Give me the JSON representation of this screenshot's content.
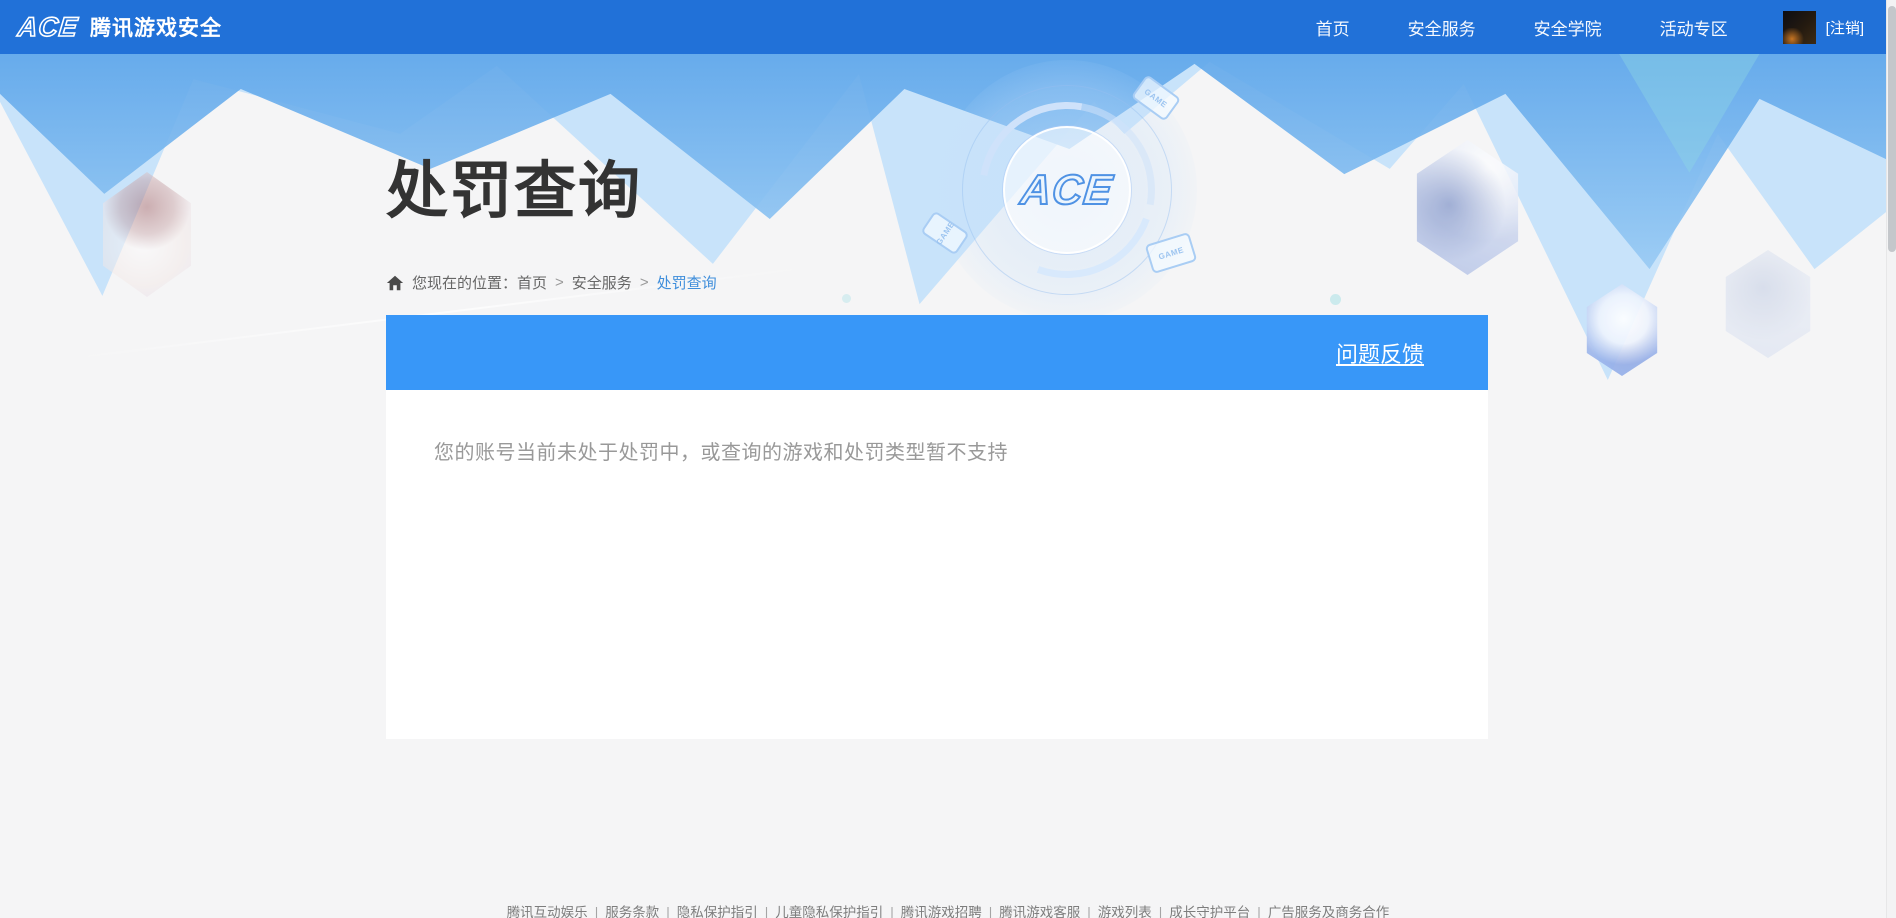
{
  "nav": {
    "logo_text": "ACE",
    "brand": "腾讯游戏安全",
    "items": [
      {
        "label": "首页"
      },
      {
        "label": "安全服务"
      },
      {
        "label": "安全学院"
      },
      {
        "label": "活动专区"
      }
    ],
    "logout_label": "[注销]"
  },
  "banner": {
    "page_title": "处罚查询",
    "breadcrumb": {
      "prefix": "您现在的位置：",
      "separator": ">",
      "items": [
        {
          "label": "首页"
        },
        {
          "label": "安全服务"
        },
        {
          "label": "处罚查询"
        }
      ]
    },
    "emblem_text": "ACE",
    "game_chip_label": "GAME"
  },
  "panel": {
    "feedback_link": "问题反馈",
    "message": "您的账号当前未处于处罚中，或查询的游戏和处罚类型暂不支持"
  },
  "footer": {
    "separator": "|",
    "links": [
      {
        "label": "腾讯互动娱乐"
      },
      {
        "label": "服务条款"
      },
      {
        "label": "隐私保护指引"
      },
      {
        "label": "儿童隐私保护指引"
      },
      {
        "label": "腾讯游戏招聘"
      },
      {
        "label": "腾讯游戏客服"
      },
      {
        "label": "游戏列表"
      },
      {
        "label": "成长守护平台"
      },
      {
        "label": "广告服务及商务合作"
      }
    ]
  },
  "icons": {
    "home": "home-icon",
    "avatar": "user-avatar"
  },
  "colors": {
    "nav_blue": "#2171d8",
    "panel_blue": "#3897f8",
    "link_blue": "#3f8edb",
    "banner_triangle_blue": "#5ca5ea",
    "banner_triangle_light": "#c5e1fa",
    "page_background": "#f5f5f6",
    "message_gray": "#999999"
  }
}
